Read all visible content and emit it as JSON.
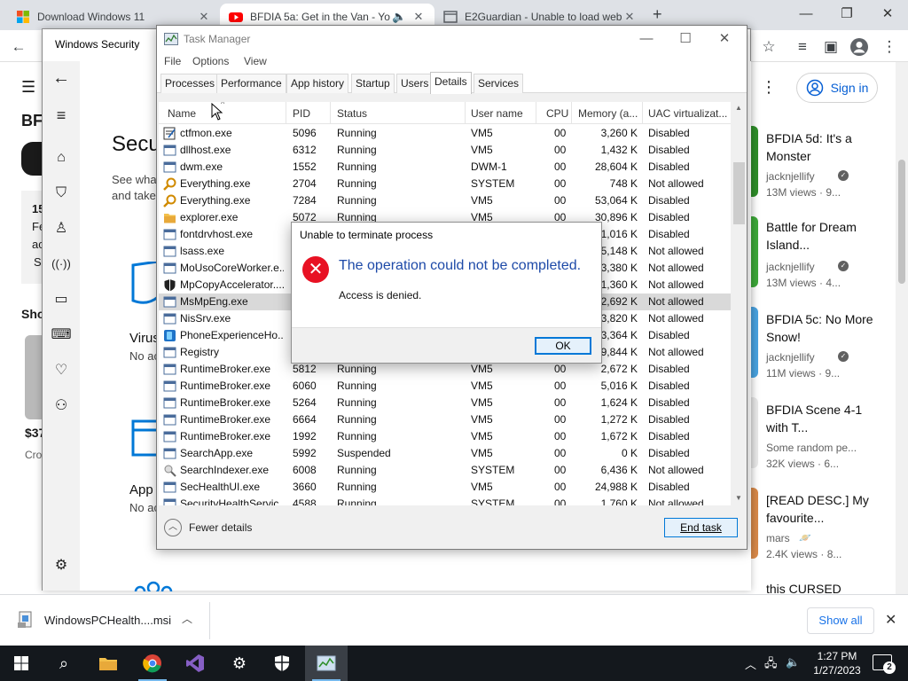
{
  "browser": {
    "tabs": [
      {
        "label": "Download Windows 11",
        "icon": "windows-logo-icon"
      },
      {
        "label": "BFDIA 5a: Get in the Van - Yo",
        "icon": "youtube-icon"
      },
      {
        "label": "E2Guardian - Unable to load web",
        "icon": "page-icon"
      }
    ],
    "new_tab": "+"
  },
  "youtube": {
    "signin": "Sign in",
    "videos": [
      {
        "title": "BFDIA 5d: It's a Monster",
        "channel": "jacknjellify",
        "views": "13M views · 9..."
      },
      {
        "title": "Battle for Dream Island...",
        "channel": "jacknjellify",
        "views": "13M views · 4..."
      },
      {
        "title": "BFDIA 5c: No More Snow!",
        "channel": "jacknjellify",
        "views": "11M views · 9..."
      },
      {
        "title": "BFDIA Scene 4-1 with T...",
        "channel": "Some random pe...",
        "views": "32K views · 6..."
      },
      {
        "title": "[READ DESC.] My favourite...",
        "channel": "mars",
        "views": "2.4K views · 8..."
      },
      {
        "title": "this CURSED",
        "channel": "",
        "views": ""
      }
    ],
    "left_fragments": {
      "t1": "BF",
      "t2": "15",
      "t3": "Fe",
      "t4": "ac",
      "t5": "S",
      "sho": "Sho",
      "price": "$37",
      "cro": "Cro"
    }
  },
  "winsec": {
    "title": "Windows Security",
    "heading": "Secu",
    "line1": "See what",
    "line2": "and take",
    "virus": "Virus",
    "virus_sub": "No ac",
    "app": "App",
    "app_sub": "No ac"
  },
  "taskmgr": {
    "title": "Task Manager",
    "menu": [
      "File",
      "Options",
      "View"
    ],
    "tabs": [
      "Processes",
      "Performance",
      "App history",
      "Startup",
      "Users",
      "Details",
      "Services"
    ],
    "active_tab": "Details",
    "columns": [
      "Name",
      "PID",
      "Status",
      "User name",
      "CPU",
      "Memory (a...",
      "UAC virtualizat..."
    ],
    "rows": [
      {
        "name": "ctfmon.exe",
        "pid": "5096",
        "status": "Running",
        "user": "VM5",
        "cpu": "00",
        "mem": "3,260 K",
        "uac": "Disabled",
        "icon": "notepad-icon"
      },
      {
        "name": "dllhost.exe",
        "pid": "6312",
        "status": "Running",
        "user": "VM5",
        "cpu": "00",
        "mem": "1,432 K",
        "uac": "Disabled",
        "icon": "window-icon"
      },
      {
        "name": "dwm.exe",
        "pid": "1552",
        "status": "Running",
        "user": "DWM-1",
        "cpu": "00",
        "mem": "28,604 K",
        "uac": "Disabled",
        "icon": "window-icon"
      },
      {
        "name": "Everything.exe",
        "pid": "2704",
        "status": "Running",
        "user": "SYSTEM",
        "cpu": "00",
        "mem": "748 K",
        "uac": "Not allowed",
        "icon": "magnifier-icon"
      },
      {
        "name": "Everything.exe",
        "pid": "7284",
        "status": "Running",
        "user": "VM5",
        "cpu": "00",
        "mem": "53,064 K",
        "uac": "Disabled",
        "icon": "magnifier-icon"
      },
      {
        "name": "explorer.exe",
        "pid": "5072",
        "status": "Running",
        "user": "VM5",
        "cpu": "00",
        "mem": "30,896 K",
        "uac": "Disabled",
        "icon": "folder-icon"
      },
      {
        "name": "fontdrvhost.exe",
        "pid": "",
        "status": "",
        "user": "",
        "cpu": "",
        "mem": "1,016 K",
        "uac": "Disabled",
        "icon": "window-icon"
      },
      {
        "name": "lsass.exe",
        "pid": "",
        "status": "",
        "user": "",
        "cpu": "",
        "mem": "5,148 K",
        "uac": "Not allowed",
        "icon": "window-icon"
      },
      {
        "name": "MoUsoCoreWorker.e...",
        "pid": "",
        "status": "",
        "user": "",
        "cpu": "",
        "mem": "3,380 K",
        "uac": "Not allowed",
        "icon": "window-icon"
      },
      {
        "name": "MpCopyAccelerator....",
        "pid": "",
        "status": "",
        "user": "",
        "cpu": "",
        "mem": "1,360 K",
        "uac": "Not allowed",
        "icon": "shield-icon"
      },
      {
        "name": "MsMpEng.exe",
        "pid": "",
        "status": "",
        "user": "",
        "cpu": "",
        "mem": "2,692 K",
        "uac": "Not allowed",
        "icon": "window-icon",
        "selected": true
      },
      {
        "name": "NisSrv.exe",
        "pid": "",
        "status": "",
        "user": "",
        "cpu": "",
        "mem": "3,820 K",
        "uac": "Not allowed",
        "icon": "window-icon"
      },
      {
        "name": "PhoneExperienceHo...",
        "pid": "",
        "status": "",
        "user": "",
        "cpu": "",
        "mem": "3,364 K",
        "uac": "Disabled",
        "icon": "phone-app-icon"
      },
      {
        "name": "Registry",
        "pid": "",
        "status": "",
        "user": "",
        "cpu": "",
        "mem": "9,844 K",
        "uac": "Not allowed",
        "icon": "window-icon"
      },
      {
        "name": "RuntimeBroker.exe",
        "pid": "5812",
        "status": "Running",
        "user": "VM5",
        "cpu": "00",
        "mem": "2,672 K",
        "uac": "Disabled",
        "icon": "window-icon"
      },
      {
        "name": "RuntimeBroker.exe",
        "pid": "6060",
        "status": "Running",
        "user": "VM5",
        "cpu": "00",
        "mem": "5,016 K",
        "uac": "Disabled",
        "icon": "window-icon"
      },
      {
        "name": "RuntimeBroker.exe",
        "pid": "5264",
        "status": "Running",
        "user": "VM5",
        "cpu": "00",
        "mem": "1,624 K",
        "uac": "Disabled",
        "icon": "window-icon"
      },
      {
        "name": "RuntimeBroker.exe",
        "pid": "6664",
        "status": "Running",
        "user": "VM5",
        "cpu": "00",
        "mem": "1,272 K",
        "uac": "Disabled",
        "icon": "window-icon"
      },
      {
        "name": "RuntimeBroker.exe",
        "pid": "1992",
        "status": "Running",
        "user": "VM5",
        "cpu": "00",
        "mem": "1,672 K",
        "uac": "Disabled",
        "icon": "window-icon"
      },
      {
        "name": "SearchApp.exe",
        "pid": "5992",
        "status": "Suspended",
        "user": "VM5",
        "cpu": "00",
        "mem": "0 K",
        "uac": "Disabled",
        "icon": "window-icon"
      },
      {
        "name": "SearchIndexer.exe",
        "pid": "6008",
        "status": "Running",
        "user": "SYSTEM",
        "cpu": "00",
        "mem": "6,436 K",
        "uac": "Not allowed",
        "icon": "search-indexer-icon"
      },
      {
        "name": "SecHealthUI.exe",
        "pid": "3660",
        "status": "Running",
        "user": "VM5",
        "cpu": "00",
        "mem": "24,988 K",
        "uac": "Disabled",
        "icon": "window-icon"
      },
      {
        "name": "SecurityHealthServic...",
        "pid": "4588",
        "status": "Running",
        "user": "SYSTEM",
        "cpu": "00",
        "mem": "1,760 K",
        "uac": "Not allowed",
        "icon": "window-icon"
      }
    ],
    "fewer_details": "Fewer details",
    "end_task": "End task"
  },
  "dialog": {
    "title": "Unable to terminate process",
    "main": "The operation could not be completed.",
    "sub": "Access is denied.",
    "ok": "OK"
  },
  "downloads": {
    "file": "WindowsPCHealth....msi",
    "show_all": "Show all"
  },
  "taskbar": {
    "time": "1:27 PM",
    "date": "1/27/2023",
    "notifications": "2"
  },
  "colors": {
    "accent": "#0078d7",
    "error": "#e81123",
    "dialog_heading": "#1e4aa8",
    "taskbar": "#14181d"
  }
}
